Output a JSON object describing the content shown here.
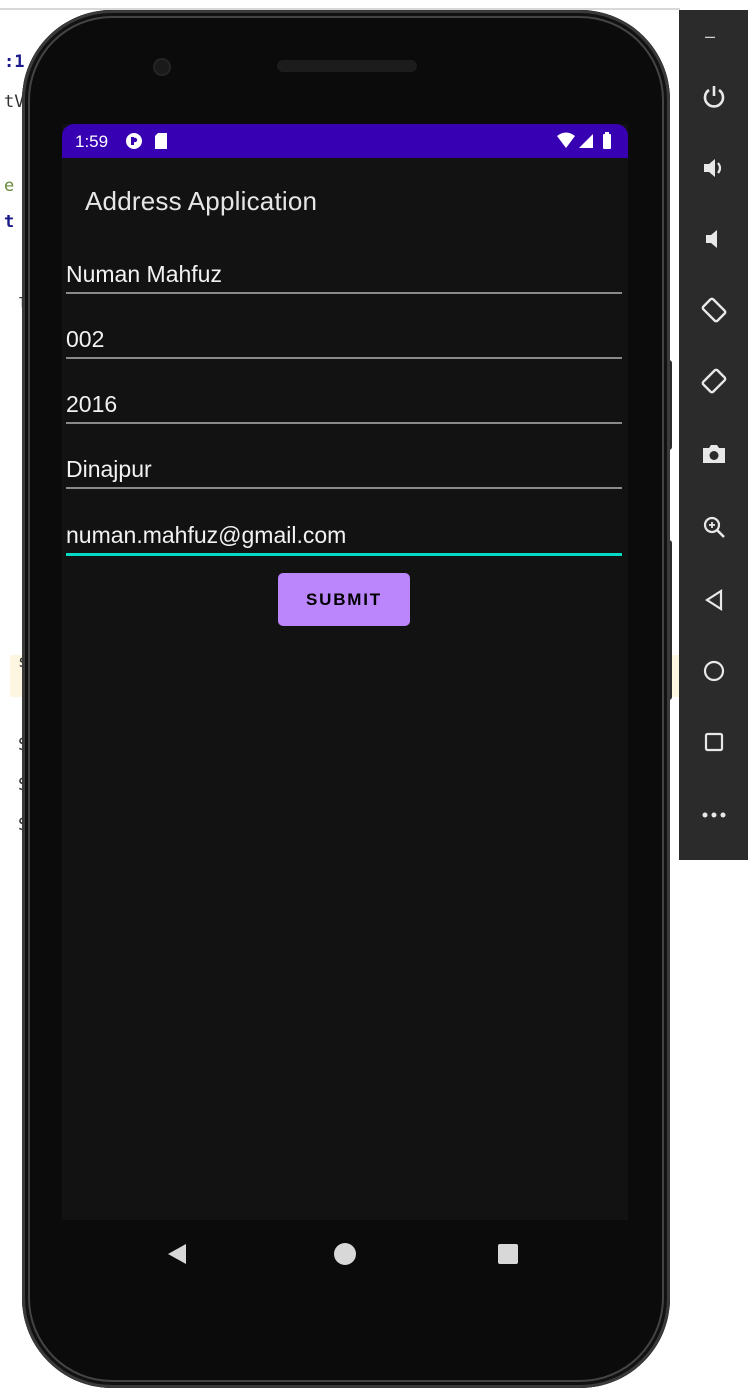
{
  "ide_background": {
    "fragments": [
      ":1",
      "tV",
      "e",
      "t",
      ":",
      "l",
      ">",
      "s",
      "S",
      "S",
      "S",
      "1",
      "S",
      "S"
    ]
  },
  "status_bar": {
    "time": "1:59",
    "color": "#3700b3"
  },
  "app": {
    "title": "Address Application",
    "fields": [
      {
        "value": "Numan Mahfuz",
        "focused": false
      },
      {
        "value": "002",
        "focused": false
      },
      {
        "value": "2016",
        "focused": false
      },
      {
        "value": "Dinajpur",
        "focused": false
      },
      {
        "value": "numan.mahfuz@gmail.com",
        "focused": true
      }
    ],
    "submit_label": "SUBMIT",
    "accent_color": "#bb86fc",
    "focus_color": "#03dac5",
    "background_color": "#121212"
  },
  "nav_bar": {
    "buttons": [
      "back-icon",
      "home-icon",
      "recents-icon"
    ]
  },
  "emulator_toolbar": {
    "top_label": "–",
    "buttons": [
      "power-icon",
      "volume-up-icon",
      "volume-down-icon",
      "rotate-left-icon",
      "rotate-right-icon",
      "camera-icon",
      "zoom-icon",
      "back-icon",
      "home-icon",
      "overview-icon",
      "more-icon"
    ]
  }
}
